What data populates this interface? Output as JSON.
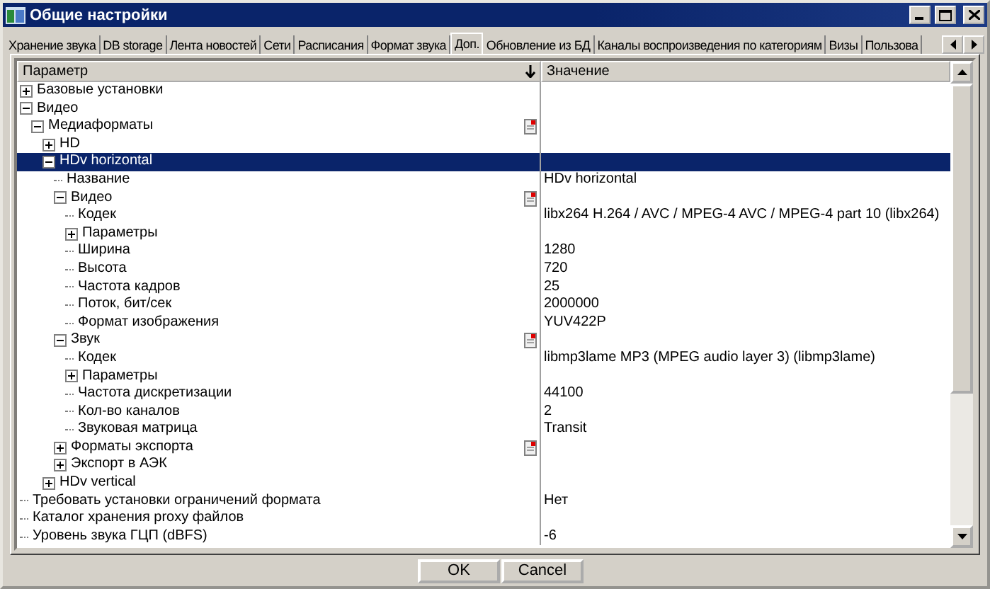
{
  "window": {
    "title": "Общие настройки"
  },
  "tabs": [
    {
      "label": "Хранение звука",
      "selected": false
    },
    {
      "label": "DB storage",
      "selected": false
    },
    {
      "label": "Лента новостей",
      "selected": false
    },
    {
      "label": "Сети",
      "selected": false
    },
    {
      "label": "Расписания",
      "selected": false
    },
    {
      "label": "Формат звука",
      "selected": false
    },
    {
      "label": "Доп.",
      "selected": true
    },
    {
      "label": "Обновление из БД",
      "selected": false
    },
    {
      "label": "Каналы воспроизведения по категориям",
      "selected": false
    },
    {
      "label": "Визы",
      "selected": false
    },
    {
      "label": "Пользова",
      "selected": false
    }
  ],
  "columns": [
    "Параметр",
    "Значение"
  ],
  "tree": [
    {
      "name": "Базовые установки",
      "expanded": false,
      "selected": false
    },
    {
      "name": "Видео",
      "expanded": true,
      "selected": false,
      "children": [
        {
          "name": "Медиаформаты",
          "expanded": true,
          "selected": false,
          "flagged": true,
          "children": [
            {
              "name": "HD",
              "expanded": false,
              "selected": false
            },
            {
              "name": "HDv horizontal",
              "expanded": true,
              "selected": true,
              "children": [
                {
                  "name": "Название",
                  "value": "HDv horizontal",
                  "selected": false
                },
                {
                  "name": "Видео",
                  "expanded": true,
                  "selected": false,
                  "flagged": true,
                  "children": [
                    {
                      "name": "Кодек",
                      "value": "libx264 H.264 / AVC / MPEG-4 AVC / MPEG-4 part 10 (libx264)",
                      "selected": false
                    },
                    {
                      "name": "Параметры",
                      "expanded": false,
                      "selected": false
                    },
                    {
                      "name": "Ширина",
                      "value": "1280",
                      "selected": false
                    },
                    {
                      "name": "Высота",
                      "value": "720",
                      "selected": false
                    },
                    {
                      "name": "Частота кадров",
                      "value": "25",
                      "selected": false
                    },
                    {
                      "name": "Поток, бит/сек",
                      "value": "2000000",
                      "selected": false
                    },
                    {
                      "name": "Формат изображения",
                      "value": "YUV422P",
                      "selected": false
                    }
                  ]
                },
                {
                  "name": "Звук",
                  "expanded": true,
                  "selected": false,
                  "flagged": true,
                  "children": [
                    {
                      "name": "Кодек",
                      "value": "libmp3lame MP3 (MPEG audio layer 3) (libmp3lame)",
                      "selected": false
                    },
                    {
                      "name": "Параметры",
                      "expanded": false,
                      "selected": false
                    },
                    {
                      "name": "Частота дискретизации",
                      "value": "44100",
                      "selected": false
                    },
                    {
                      "name": "Кол-во каналов",
                      "value": "2",
                      "selected": false
                    },
                    {
                      "name": "Звуковая матрица",
                      "value": "Transit",
                      "selected": false
                    }
                  ]
                },
                {
                  "name": "Форматы экспорта",
                  "expanded": false,
                  "selected": false,
                  "flagged": true
                },
                {
                  "name": "Экспорт в АЭК",
                  "expanded": false,
                  "selected": false
                }
              ]
            },
            {
              "name": "HDv vertical",
              "expanded": false,
              "selected": false
            }
          ]
        }
      ]
    },
    {
      "name": "Требовать установки ограничений формата",
      "value": "Нет",
      "selected": false
    },
    {
      "name": "Каталог хранения proxy файлов",
      "selected": false
    },
    {
      "name": "Уровень звука ГЦП (dBFS)",
      "value": "-6",
      "selected": false
    }
  ],
  "buttons": [
    "OK",
    "Cancel"
  ]
}
